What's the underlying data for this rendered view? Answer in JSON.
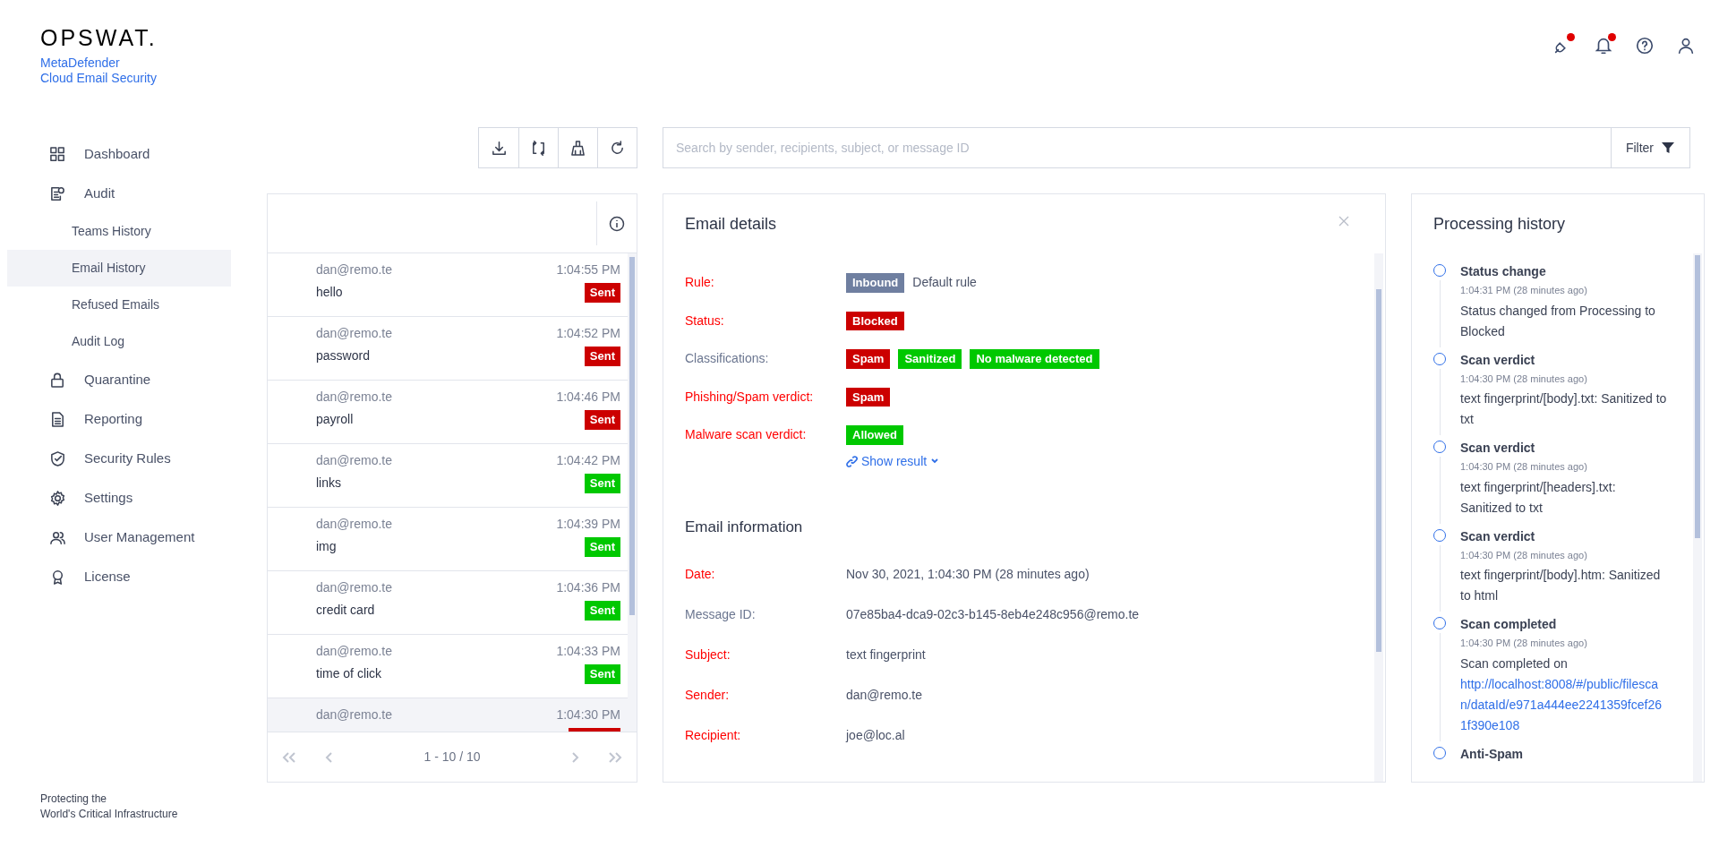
{
  "brand": {
    "logo": "OPSWAT.",
    "product_line_1": "MetaDefender",
    "product_line_2": "Cloud Email Security"
  },
  "header_icons": [
    {
      "kind": "plug",
      "badge": true
    },
    {
      "kind": "bell",
      "badge": true
    },
    {
      "kind": "help",
      "badge": false
    },
    {
      "kind": "user",
      "badge": false
    }
  ],
  "sidebar": {
    "items": [
      {
        "label": "Dashboard",
        "kind": "grid",
        "selected": false
      },
      {
        "label": "Audit",
        "kind": "audit",
        "selected": false,
        "children": [
          {
            "label": "Teams History",
            "selected": false
          },
          {
            "label": "Email History",
            "selected": true
          },
          {
            "label": "Refused Emails",
            "selected": false
          },
          {
            "label": "Audit Log",
            "selected": false
          }
        ]
      },
      {
        "label": "Quarantine",
        "kind": "lock",
        "selected": false
      },
      {
        "label": "Reporting",
        "kind": "doc",
        "selected": false
      },
      {
        "label": "Security Rules",
        "kind": "shield",
        "selected": false
      },
      {
        "label": "Settings",
        "kind": "gear",
        "selected": false
      },
      {
        "label": "User Management",
        "kind": "users",
        "selected": false
      },
      {
        "label": "License",
        "kind": "award",
        "selected": false
      }
    ],
    "footer_line_1": "Protecting the",
    "footer_line_2": "World's Critical Infrastructure"
  },
  "toolbar": [
    {
      "kind": "download"
    },
    {
      "kind": "sync"
    },
    {
      "kind": "broom"
    },
    {
      "kind": "refresh"
    }
  ],
  "search": {
    "placeholder": "Search by sender, recipients, subject, or message ID"
  },
  "filter_button": "Filter",
  "email_list": {
    "rows": [
      {
        "sender": "dan@remo.te",
        "time": "1:04:55 PM",
        "subject": "hello",
        "badge": {
          "label": "Sent",
          "color": "#cc0000"
        },
        "selected": false
      },
      {
        "sender": "dan@remo.te",
        "time": "1:04:52 PM",
        "subject": "password",
        "badge": {
          "label": "Sent",
          "color": "#cc0000"
        },
        "selected": false
      },
      {
        "sender": "dan@remo.te",
        "time": "1:04:46 PM",
        "subject": "payroll",
        "badge": {
          "label": "Sent",
          "color": "#cc0000"
        },
        "selected": false
      },
      {
        "sender": "dan@remo.te",
        "time": "1:04:42 PM",
        "subject": "links",
        "badge": {
          "label": "Sent",
          "color": "#00c800"
        },
        "selected": false
      },
      {
        "sender": "dan@remo.te",
        "time": "1:04:39 PM",
        "subject": "img",
        "badge": {
          "label": "Sent",
          "color": "#00c800"
        },
        "selected": false
      },
      {
        "sender": "dan@remo.te",
        "time": "1:04:36 PM",
        "subject": "credit card",
        "badge": {
          "label": "Sent",
          "color": "#00c800"
        },
        "selected": false
      },
      {
        "sender": "dan@remo.te",
        "time": "1:04:33 PM",
        "subject": "time of click",
        "badge": {
          "label": "Sent",
          "color": "#00c800"
        },
        "selected": false
      },
      {
        "sender": "dan@remo.te",
        "time": "1:04:30 PM",
        "badge": {
          "color": "#cc0000"
        },
        "selected": true
      }
    ],
    "pagination": "1 - 10 / 10"
  },
  "email_details": {
    "title": "Email details",
    "fields": [
      {
        "label": "Rule:",
        "highlighted": true,
        "tags": [
          {
            "label": "Inbound",
            "color": "#6f7fa0"
          }
        ],
        "value": "Default rule"
      },
      {
        "label": "Status:",
        "highlighted": true,
        "tags": [
          {
            "label": "Blocked",
            "color": "#cc0000"
          }
        ]
      },
      {
        "label": "Classifications:",
        "highlighted": false,
        "tags": [
          {
            "label": "Spam",
            "color": "#cc0000"
          },
          {
            "label": "Sanitized",
            "color": "#00c800"
          },
          {
            "label": "No malware detected",
            "color": "#00c800"
          }
        ]
      },
      {
        "label": "Phishing/Spam verdict:",
        "highlighted": true,
        "tags": [
          {
            "label": "Spam",
            "color": "#cc0000"
          }
        ]
      },
      {
        "label": "Malware scan verdict:",
        "highlighted": true,
        "tags": [
          {
            "label": "Allowed",
            "color": "#00c800"
          }
        ],
        "link": "Show result"
      }
    ],
    "info_title": "Email information",
    "info": [
      {
        "label": "Date:",
        "highlighted": true,
        "value": "Nov 30, 2021, 1:04:30 PM (28 minutes ago)"
      },
      {
        "label": "Message ID:",
        "highlighted": false,
        "value": "07e85ba4-dca9-02c3-b145-8eb4e248c956@remo.te"
      },
      {
        "label": "Subject:",
        "highlighted": true,
        "value": "text fingerprint"
      },
      {
        "label": "Sender:",
        "highlighted": true,
        "value": "dan@remo.te"
      },
      {
        "label": "Recipient:",
        "highlighted": true,
        "value": "joe@loc.al"
      }
    ]
  },
  "processing_history": {
    "title": "Processing history",
    "events": [
      {
        "title": "Status change",
        "time": "1:04:31 PM (28 minutes ago)",
        "text": "Status changed from Processing to Blocked"
      },
      {
        "title": "Scan verdict",
        "time": "1:04:30 PM (28 minutes ago)",
        "text": "text fingerprint/[body].txt: Sanitized to txt"
      },
      {
        "title": "Scan verdict",
        "time": "1:04:30 PM (28 minutes ago)",
        "text": "text fingerprint/[headers].txt: Sanitized to txt"
      },
      {
        "title": "Scan verdict",
        "time": "1:04:30 PM (28 minutes ago)",
        "text": "text fingerprint/[body].htm: Sanitized to html"
      },
      {
        "title": "Scan completed",
        "time": "1:04:30 PM (28 minutes ago)",
        "text": "Scan completed on",
        "link": "http://localhost:8008/#/public/filescan/dataId/e971a444ee2241359fcef261f390e108"
      },
      {
        "title": "Anti-Spam"
      }
    ]
  }
}
